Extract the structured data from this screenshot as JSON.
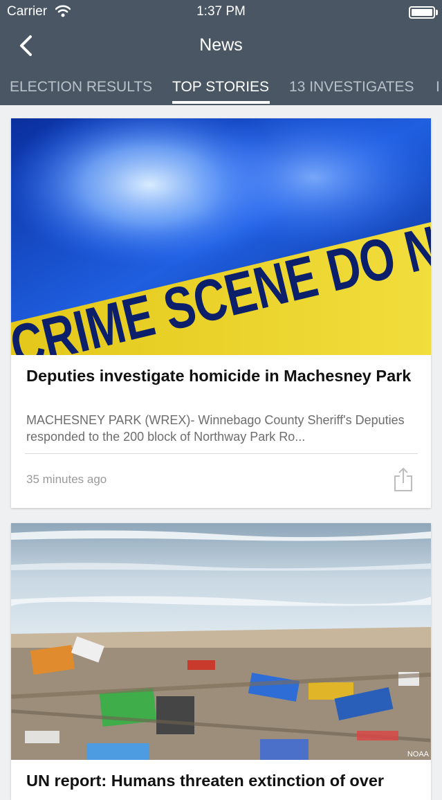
{
  "status_bar": {
    "carrier": "Carrier",
    "time": "1:37 PM"
  },
  "nav": {
    "title": "News",
    "back_icon": "chevron-left-icon"
  },
  "tabs": [
    {
      "label": "ELECTION RESULTS",
      "active": false
    },
    {
      "label": "TOP STORIES",
      "active": true
    },
    {
      "label": "13 INVESTIGATES",
      "active": false
    },
    {
      "label": "I",
      "active": false
    }
  ],
  "articles": [
    {
      "image_text": "CRIME SCENE DO NOT",
      "headline": "Deputies investigate homicide in Machesney Park",
      "summary": "MACHESNEY PARK (WREX)- Winnebago County Sheriff's Deputies responded to the 200 block of Northway Park Ro...",
      "time_ago": "35 minutes ago",
      "share_icon": "share-icon"
    },
    {
      "image_credit": "NOAA",
      "headline": "UN report: Humans threaten extinction of over"
    }
  ],
  "colors": {
    "header": "#4a5663",
    "background": "#eef0f2",
    "tab_inactive": "#b9c1ca"
  }
}
